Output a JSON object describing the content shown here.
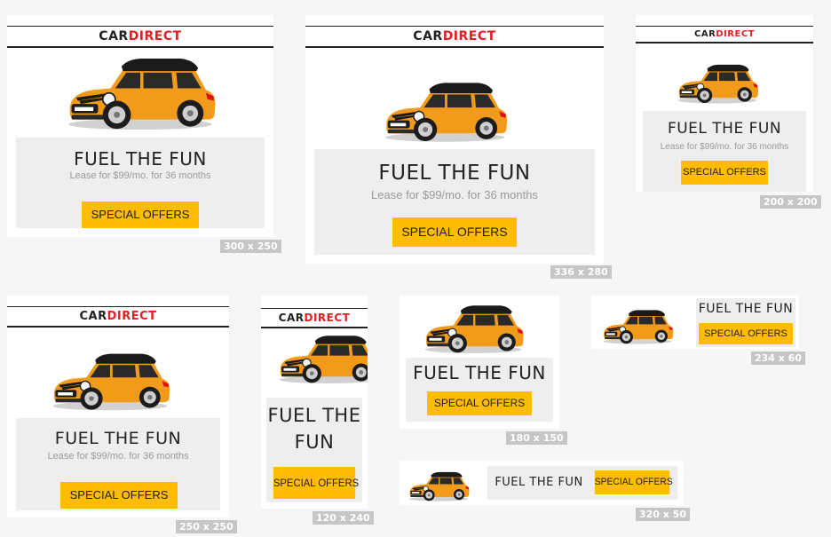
{
  "brand": {
    "car": "CAR",
    "direct": "DIRECT"
  },
  "headline": "FUEL THE FUN",
  "headline_line1": "FUEL THE",
  "headline_line2": "FUN",
  "subline": "Lease for $99/mo. for 36 months",
  "cta": "SPECIAL OFFERS",
  "colors": {
    "accent": "#ffbc00",
    "brand_red": "#e31e24",
    "panel": "#eeeeee",
    "car_body": "#f29a1a",
    "size_tag": "#c6c6c6"
  },
  "icons": {
    "car": "mini-cooper-car-icon"
  },
  "sizes": {
    "s300x250": "300 x 250",
    "s336x280": "336 x 280",
    "s200x200": "200 x 200",
    "s250x250": "250 x 250",
    "s120x240": "120 x 240",
    "s180x150": "180 x 150",
    "s234x60": "234 x 60",
    "s320x50": "320 x 50"
  }
}
